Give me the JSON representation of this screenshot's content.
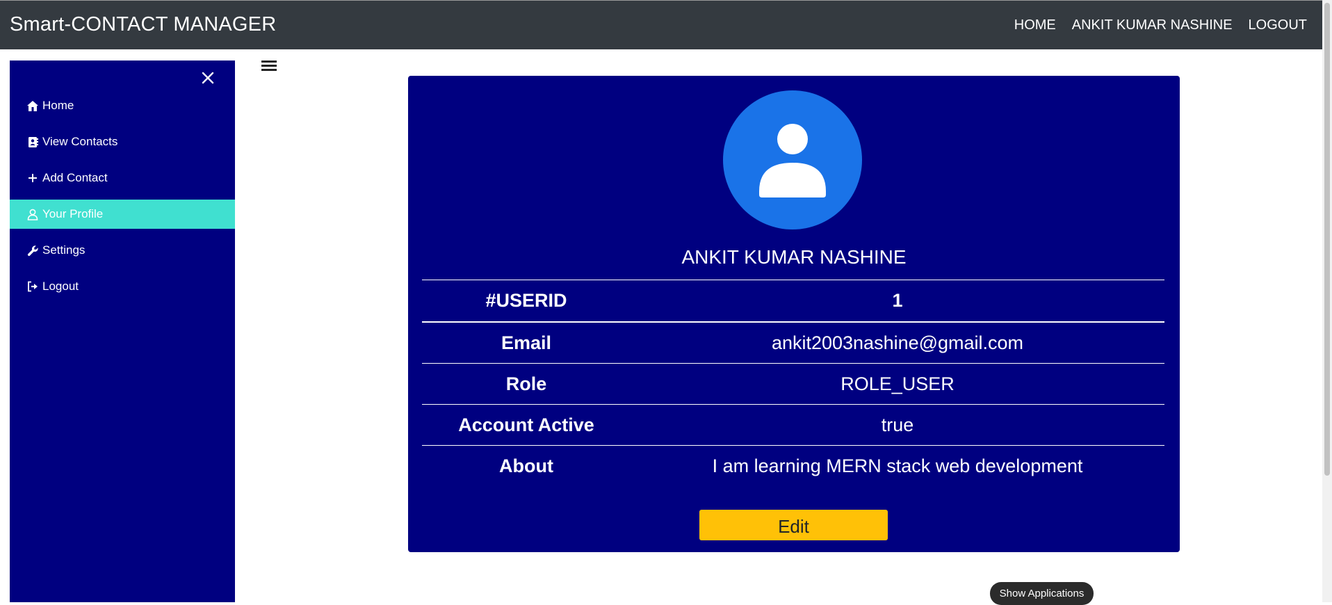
{
  "header": {
    "brand": "Smart-CONTACT MANAGER",
    "nav": [
      {
        "label": "HOME"
      },
      {
        "label": "ANKIT KUMAR NASHINE"
      },
      {
        "label": "LOGOUT"
      }
    ]
  },
  "sidebar": {
    "close_icon": "close-icon",
    "items": [
      {
        "label": "Home",
        "icon": "home-icon"
      },
      {
        "label": "View Contacts",
        "icon": "contacts-book-icon"
      },
      {
        "label": "Add Contact",
        "icon": "plus-icon"
      },
      {
        "label": "Your Profile",
        "icon": "user-icon",
        "active": true
      },
      {
        "label": "Settings",
        "icon": "wrench-icon"
      },
      {
        "label": "Logout",
        "icon": "logout-icon"
      }
    ]
  },
  "profile": {
    "name": "ANKIT KUMAR NASHINE",
    "rows": [
      {
        "key": "#USERID",
        "value": "1"
      },
      {
        "key": "Email",
        "value": "ankit2003nashine@gmail.com"
      },
      {
        "key": "Role",
        "value": "ROLE_USER"
      },
      {
        "key": "Account Active",
        "value": "true"
      },
      {
        "key": "About",
        "value": "I am learning MERN stack web development"
      }
    ],
    "edit_label": "Edit"
  },
  "taskbar": {
    "show_apps_label": "Show Applications"
  },
  "colors": {
    "topbar": "#343a40",
    "sidebar": "#000080",
    "active_item": "#40e0d0",
    "card": "#000080",
    "avatar_bg": "#1a73e8",
    "edit_button": "#ffc107"
  }
}
